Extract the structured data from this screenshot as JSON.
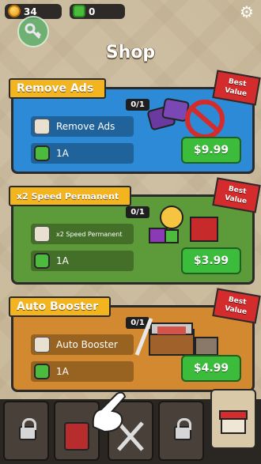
{
  "currency": {
    "coins": "34",
    "gems": "0"
  },
  "title": "Shop",
  "cards": [
    {
      "title": "Remove Ads",
      "count": "0/1",
      "item_label": "Remove Ads",
      "cost_label": "1A",
      "price": "$9.99",
      "ribbon": [
        "Best",
        "Value"
      ]
    },
    {
      "title": "x2 Speed Permanent",
      "count": "0/1",
      "item_label": "x2 Speed Permanent",
      "cost_label": "1A",
      "price": "$3.99",
      "ribbon": [
        "Best",
        "Value"
      ]
    },
    {
      "title": "Auto Booster",
      "count": "0/1",
      "item_label": "Auto Booster",
      "cost_label": "1A",
      "price": "$4.99",
      "ribbon": [
        "Best",
        "Value"
      ]
    }
  ],
  "colors": {
    "blue": "#2d8ad6",
    "green": "#5d9a3a",
    "orange": "#d3892f",
    "price_green": "#3bbd3b",
    "header_gold": "#f2b41f",
    "ribbon_red": "#d42c2c"
  },
  "icons": [
    "coin-icon",
    "gem-icon",
    "gear-icon",
    "key-icon",
    "lock-icon",
    "hand-cursor-icon",
    "shop-icon",
    "battle-icon"
  ]
}
